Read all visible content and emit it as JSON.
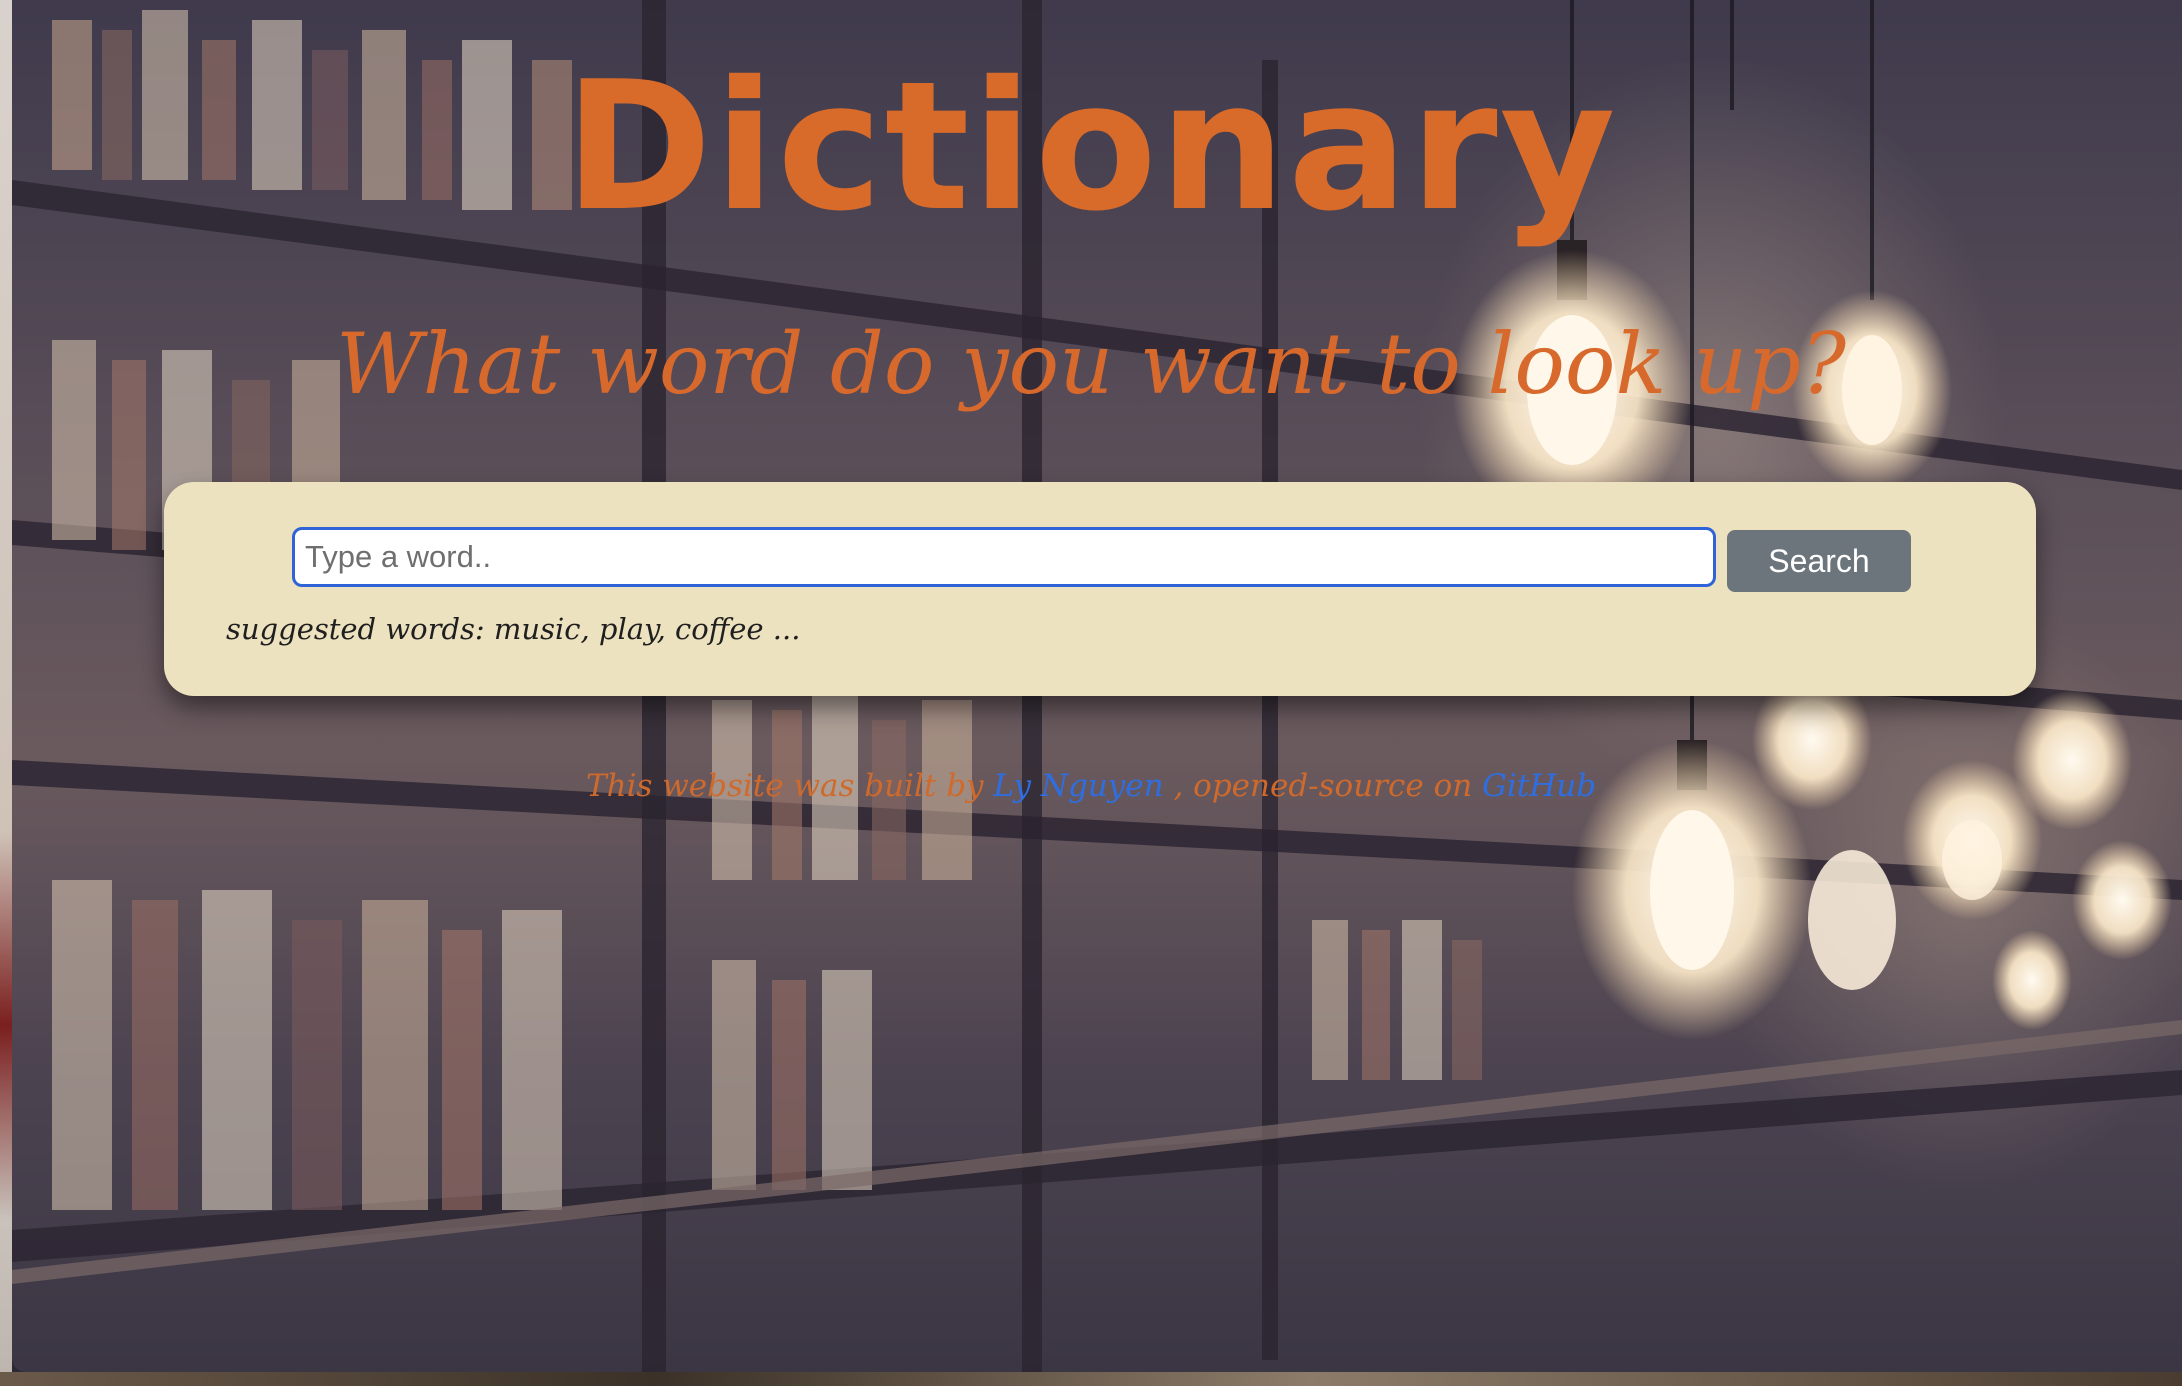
{
  "header": {
    "title": "Dictionary",
    "subtitle": "What word do you want to look up?"
  },
  "search": {
    "placeholder": "Type a word..",
    "value": "",
    "button_label": "Search",
    "suggested": "suggested words: music, play, coffee ..."
  },
  "footer": {
    "prefix": "This website was built by",
    "author_link": "Ly Nguyen",
    "middle": ", opened-source on",
    "repo_link": "GitHub"
  },
  "colors": {
    "accent": "#d86a2a",
    "card_background": "#ede2bf",
    "input_border": "#2f63d8",
    "button_background": "#6c757c",
    "link": "#2f6ee0"
  },
  "icons": {
    "background": "library-bookshelf-image"
  }
}
